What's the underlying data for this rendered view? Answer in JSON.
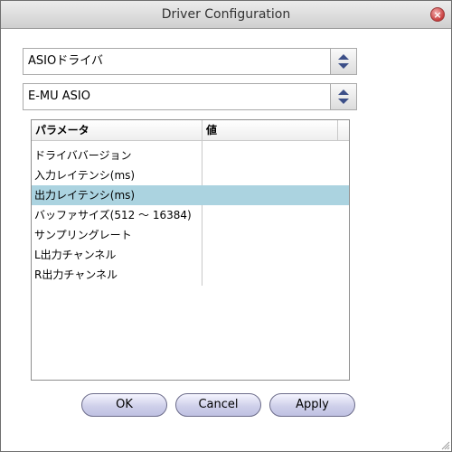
{
  "window": {
    "title": "Driver Configuration"
  },
  "driver_type_select": {
    "value": "ASIOドライバ"
  },
  "device_select": {
    "value": "E-MU ASIO"
  },
  "table": {
    "headers": [
      "パラメータ",
      "値"
    ],
    "rows": [
      {
        "param": "ドライババージョン",
        "value": ""
      },
      {
        "param": "入力レイテンシ(ms)",
        "value": ""
      },
      {
        "param": "出力レイテンシ(ms)",
        "value": "",
        "selected": true
      },
      {
        "param": "バッファサイズ(512 ～ 16384)",
        "value": ""
      },
      {
        "param": "サンプリングレート",
        "value": ""
      },
      {
        "param": "L出力チャンネル",
        "value": ""
      },
      {
        "param": "R出力チャンネル",
        "value": ""
      }
    ]
  },
  "buttons": {
    "ok": "OK",
    "cancel": "Cancel",
    "apply": "Apply"
  },
  "colors": {
    "selected_row": "#abd3e0",
    "button_fill": "#cfd0ea"
  },
  "icons": {
    "close": "close-icon",
    "spinner": "up-down-arrows-icon",
    "resize": "resize-grip-icon"
  }
}
